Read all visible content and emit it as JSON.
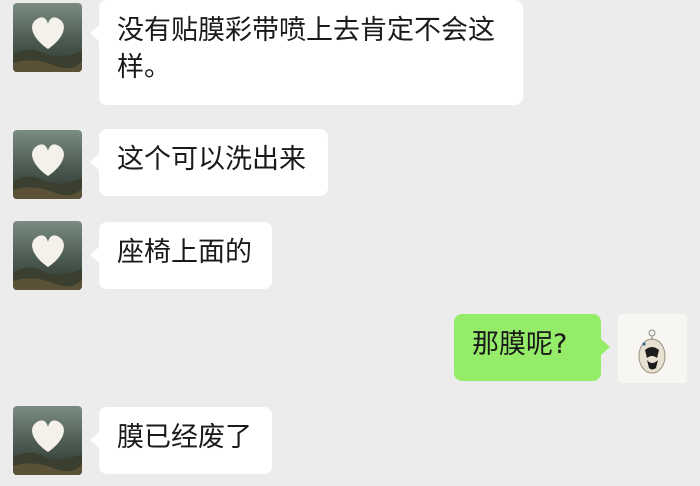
{
  "colors": {
    "background": "#ececec",
    "incoming_bubble": "#ffffff",
    "outgoing_bubble": "#95ec69",
    "text": "#1a1a1a"
  },
  "contact": {
    "avatar_icon": "heart-cloud-landscape-avatar"
  },
  "me": {
    "avatar_icon": "sketch-character-avatar"
  },
  "messages": [
    {
      "direction": "incoming",
      "text": "没有贴膜彩带喷上去肯定不会这\n样。"
    },
    {
      "direction": "incoming",
      "text": "这个可以洗出来"
    },
    {
      "direction": "incoming",
      "text": "座椅上面的"
    },
    {
      "direction": "outgoing",
      "text": "那膜呢?"
    },
    {
      "direction": "incoming",
      "text": "膜已经废了"
    }
  ]
}
